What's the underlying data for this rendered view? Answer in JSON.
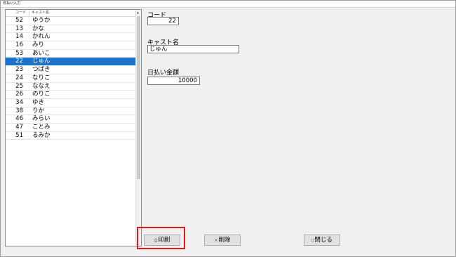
{
  "window": {
    "title": "日払い入力"
  },
  "list": {
    "headers": {
      "code": "コード",
      "name": "キャスト名"
    },
    "rows": [
      {
        "code": "52",
        "name": "ゆうか"
      },
      {
        "code": "13",
        "name": "かな"
      },
      {
        "code": "14",
        "name": "かれん"
      },
      {
        "code": "16",
        "name": "みり"
      },
      {
        "code": "53",
        "name": "あいこ"
      },
      {
        "code": "22",
        "name": "じゅん"
      },
      {
        "code": "23",
        "name": "つばき"
      },
      {
        "code": "24",
        "name": "なりこ"
      },
      {
        "code": "25",
        "name": "ななえ"
      },
      {
        "code": "26",
        "name": "のりこ"
      },
      {
        "code": "34",
        "name": "ゆき"
      },
      {
        "code": "38",
        "name": "りか"
      },
      {
        "code": "46",
        "name": "みらい"
      },
      {
        "code": "47",
        "name": "ことみ"
      },
      {
        "code": "51",
        "name": "るみか"
      }
    ],
    "selected_index": 5,
    "selection_color": "#1c72c8"
  },
  "form": {
    "code_label": "コード",
    "code_value": "22",
    "name_label": "キャスト名",
    "name_value": "じゅん",
    "amount_label": "日払い金額",
    "amount_value": "10000"
  },
  "buttons": {
    "print": {
      "label": "印刷",
      "icon": "printer-icon"
    },
    "delete": {
      "label": "削除",
      "icon": "delete-icon"
    },
    "close": {
      "label": "閉じる",
      "icon": "door-icon"
    }
  },
  "highlight_color": "#e01818"
}
